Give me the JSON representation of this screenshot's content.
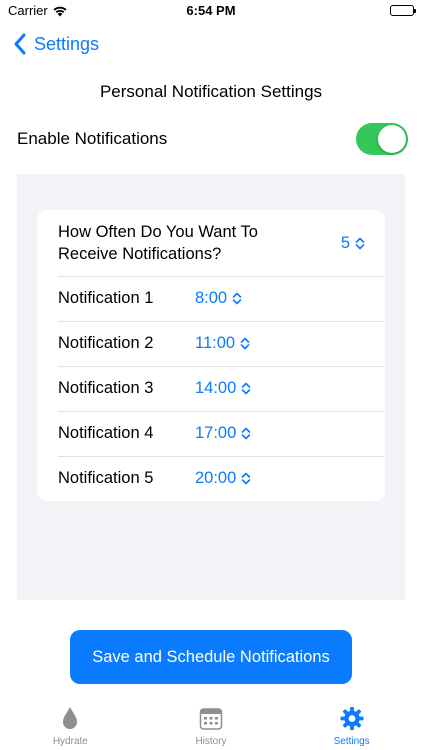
{
  "status_bar": {
    "carrier": "Carrier",
    "time": "6:54 PM"
  },
  "nav": {
    "back_label": "Settings"
  },
  "page": {
    "title": "Personal Notification Settings"
  },
  "enable": {
    "label": "Enable Notifications",
    "on": true
  },
  "frequency": {
    "question": "How Often Do You Want To Receive Notifications?",
    "value": "5"
  },
  "notifications": [
    {
      "label": "Notification 1",
      "time": "8:00"
    },
    {
      "label": "Notification 2",
      "time": "11:00"
    },
    {
      "label": "Notification 3",
      "time": "14:00"
    },
    {
      "label": "Notification 4",
      "time": "17:00"
    },
    {
      "label": "Notification 5",
      "time": "20:00"
    }
  ],
  "save_button": {
    "label": "Save and Schedule Notifications"
  },
  "tabs": [
    {
      "label": "Hydrate",
      "icon": "drop-icon",
      "active": false
    },
    {
      "label": "History",
      "icon": "calendar-icon",
      "active": false
    },
    {
      "label": "Settings",
      "icon": "gear-icon",
      "active": true
    }
  ],
  "colors": {
    "accent": "#0a7aff",
    "toggle_on": "#34c759",
    "panel_bg": "#f2f2f7",
    "inactive": "#8e8e93"
  }
}
